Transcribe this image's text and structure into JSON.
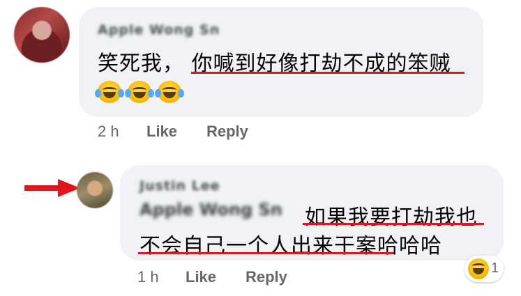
{
  "comments": [
    {
      "author": "Apple Wong Sn",
      "text": "笑死我， 你喊到好像打劫不成的笨贼",
      "emojis": [
        "laughing-crying-emoji",
        "laughing-crying-emoji",
        "laughing-crying-emoji"
      ],
      "time": "2 h",
      "like_label": "Like",
      "reply_label": "Reply"
    },
    {
      "author": "Justin Lee",
      "mention": "Apple Wong Sn",
      "text_line1": "如果我要打劫我也",
      "text_line2": "不会自己一个人出来干案哈哈哈",
      "time": "1 h",
      "like_label": "Like",
      "reply_label": "Reply",
      "reaction": {
        "icon": "laughing-squint-emoji",
        "count": "1"
      }
    }
  ],
  "colors": {
    "bubble": "#f0f2f5",
    "underline": "#e0161c",
    "meta": "#65676b",
    "arrow": "#e0161c"
  }
}
